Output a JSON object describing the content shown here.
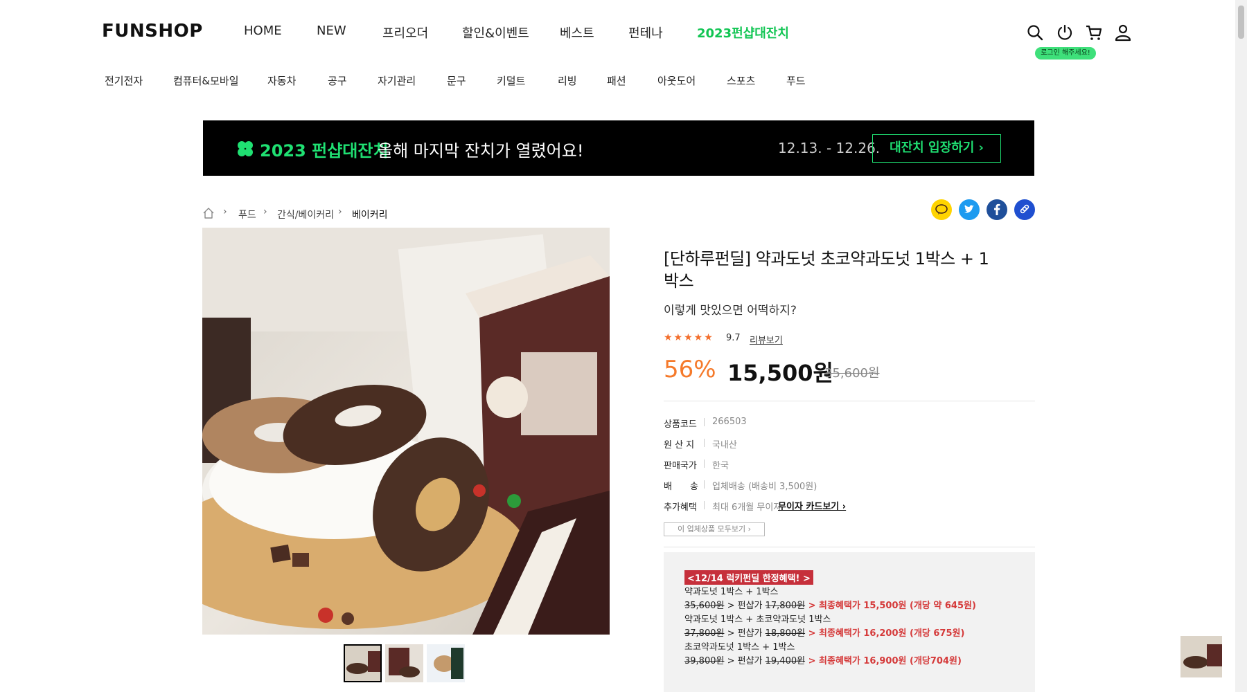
{
  "header": {
    "logo": "FUNSHOP",
    "nav": [
      "HOME",
      "NEW",
      "프리오더",
      "할인&이벤트",
      "베스트",
      "펀테나",
      "2023펀샵대잔치"
    ],
    "login_tip": "로그인 해주세요!"
  },
  "categories": [
    "전기전자",
    "컴퓨터&모바일",
    "자동차",
    "공구",
    "자기관리",
    "문구",
    "키덜트",
    "리빙",
    "패션",
    "아웃도어",
    "스포츠",
    "푸드"
  ],
  "banner": {
    "title": "2023 펀샵대잔치",
    "subtitle": "올해 마지막 잔치가 열렸어요!",
    "date": "12.13. - 12.26.",
    "button": "대잔치 입장하기 ›"
  },
  "breadcrumb": [
    "푸드",
    "간식/베이커리",
    "베이커리"
  ],
  "product": {
    "title": "[단하루펀딜] 약과도넛 초코약과도넛 1박스 + 1박스",
    "subtitle": "이렇게 맛있으면 어떡하지?",
    "rating": "9.7",
    "review_link": "리뷰보기",
    "discount": "56%",
    "price": "15,500원",
    "original_price": "35,600원",
    "info": [
      {
        "label": "상품코드",
        "value": "266503"
      },
      {
        "label": "원 산 지",
        "value": "국내산"
      },
      {
        "label": "판매국가",
        "value": "한국"
      },
      {
        "label": "배　　송",
        "value": "업체배송 (배송비 3,500원)"
      },
      {
        "label": "추가혜택",
        "value": "최대 6개월 무이자"
      }
    ],
    "card_link": "무이자 카드보기 ›",
    "vendor_button": "이 업체상품 모두보기 ›"
  },
  "benefit": {
    "tag": "<12/14 럭키펀딜 한정혜택! >",
    "lines": [
      {
        "name": "약과도넛 1박스 + 1박스",
        "orig": "35,600원",
        "mid": " > 펀샵가 ",
        "fun": "17,800원",
        "final": " > 최종혜택가 15,500원 (개당 약 645원)"
      },
      {
        "name": "약과도넛 1박스 + 초코약과도넛 1박스",
        "orig": "37,800원",
        "mid": " > 펀샵가 ",
        "fun": "18,800원",
        "final": " > 최종혜택가 16,200원 (개당 675원)"
      },
      {
        "name": "초코약과도넛 1박스 + 1박스",
        "orig": "39,800원",
        "mid": " > 펀샵가 ",
        "fun": "19,400원",
        "final": " > 최종혜택가 16,900원 (개당704원)"
      }
    ]
  },
  "colors": {
    "accent_green": "#11c553",
    "discount_orange": "#f57a2b",
    "benefit_red": "#c6303b"
  },
  "icons": [
    "home-icon",
    "search-icon",
    "power-icon",
    "cart-icon",
    "user-icon",
    "kakao-icon",
    "twitter-icon",
    "facebook-icon",
    "link-icon",
    "clover-icon"
  ]
}
